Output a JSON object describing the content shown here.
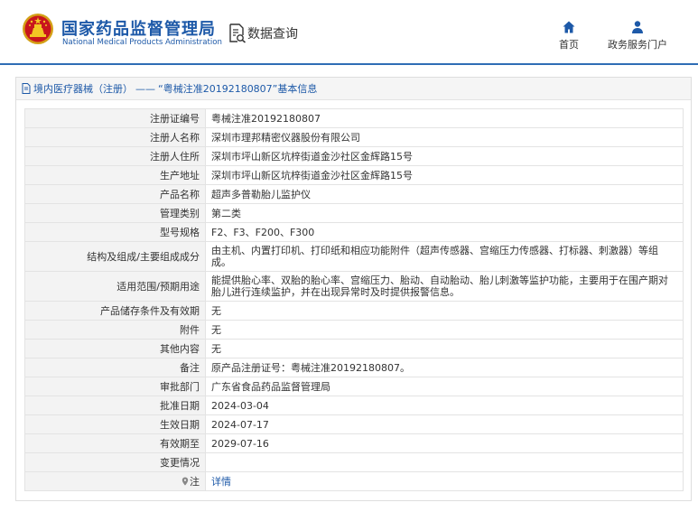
{
  "header": {
    "org_cn": "国家药品监督管理局",
    "org_en": "National Medical Products Administration",
    "query_title": "数据查询",
    "nav": {
      "home_label": "首页",
      "portal_label": "政务服务门户"
    }
  },
  "panel": {
    "crumb_link": "境内医疗器械（注册）",
    "crumb_sep": "——",
    "crumb_title": "“粤械注准20192180807”基本信息"
  },
  "rows": [
    {
      "label": "注册证编号",
      "value": "粤械注准20192180807"
    },
    {
      "label": "注册人名称",
      "value": "深圳市理邦精密仪器股份有限公司"
    },
    {
      "label": "注册人住所",
      "value": "深圳市坪山新区坑梓街道金沙社区金辉路15号"
    },
    {
      "label": "生产地址",
      "value": "深圳市坪山新区坑梓街道金沙社区金辉路15号"
    },
    {
      "label": "产品名称",
      "value": "超声多普勒胎儿监护仪"
    },
    {
      "label": "管理类别",
      "value": "第二类"
    },
    {
      "label": "型号规格",
      "value": "F2、F3、F200、F300"
    },
    {
      "label": "结构及组成/主要组成成分",
      "value": "由主机、内置打印机、打印纸和相应功能附件（超声传感器、宫缩压力传感器、打标器、刺激器）等组成。"
    },
    {
      "label": "适用范围/预期用途",
      "value": "能提供胎心率、双胎的胎心率、宫缩压力、胎动、自动胎动、胎儿刺激等监护功能，主要用于在围产期对胎儿进行连续监护，并在出现异常时及时提供报警信息。"
    },
    {
      "label": "产品储存条件及有效期",
      "value": "无"
    },
    {
      "label": "附件",
      "value": "无"
    },
    {
      "label": "其他内容",
      "value": "无"
    },
    {
      "label": "备注",
      "value": "原产品注册证号：粤械注准20192180807。"
    },
    {
      "label": "审批部门",
      "value": "广东省食品药品监督管理局"
    },
    {
      "label": "批准日期",
      "value": "2024-03-04"
    },
    {
      "label": "生效日期",
      "value": "2024-07-17"
    },
    {
      "label": "有效期至",
      "value": "2029-07-16"
    },
    {
      "label": "变更情况",
      "value": ""
    },
    {
      "label": "注",
      "value": "详情"
    }
  ],
  "icons": {
    "emblem": "national-emblem-icon",
    "query": "document-search-icon",
    "home": "home-icon",
    "portal": "user-icon",
    "crumb": "document-icon",
    "note": "location-pin-icon"
  },
  "colors": {
    "brand_blue": "#1d59a8",
    "header_rule": "#2f6db5",
    "label_bg": "#f3f3f3",
    "border": "#e3e3e3"
  }
}
